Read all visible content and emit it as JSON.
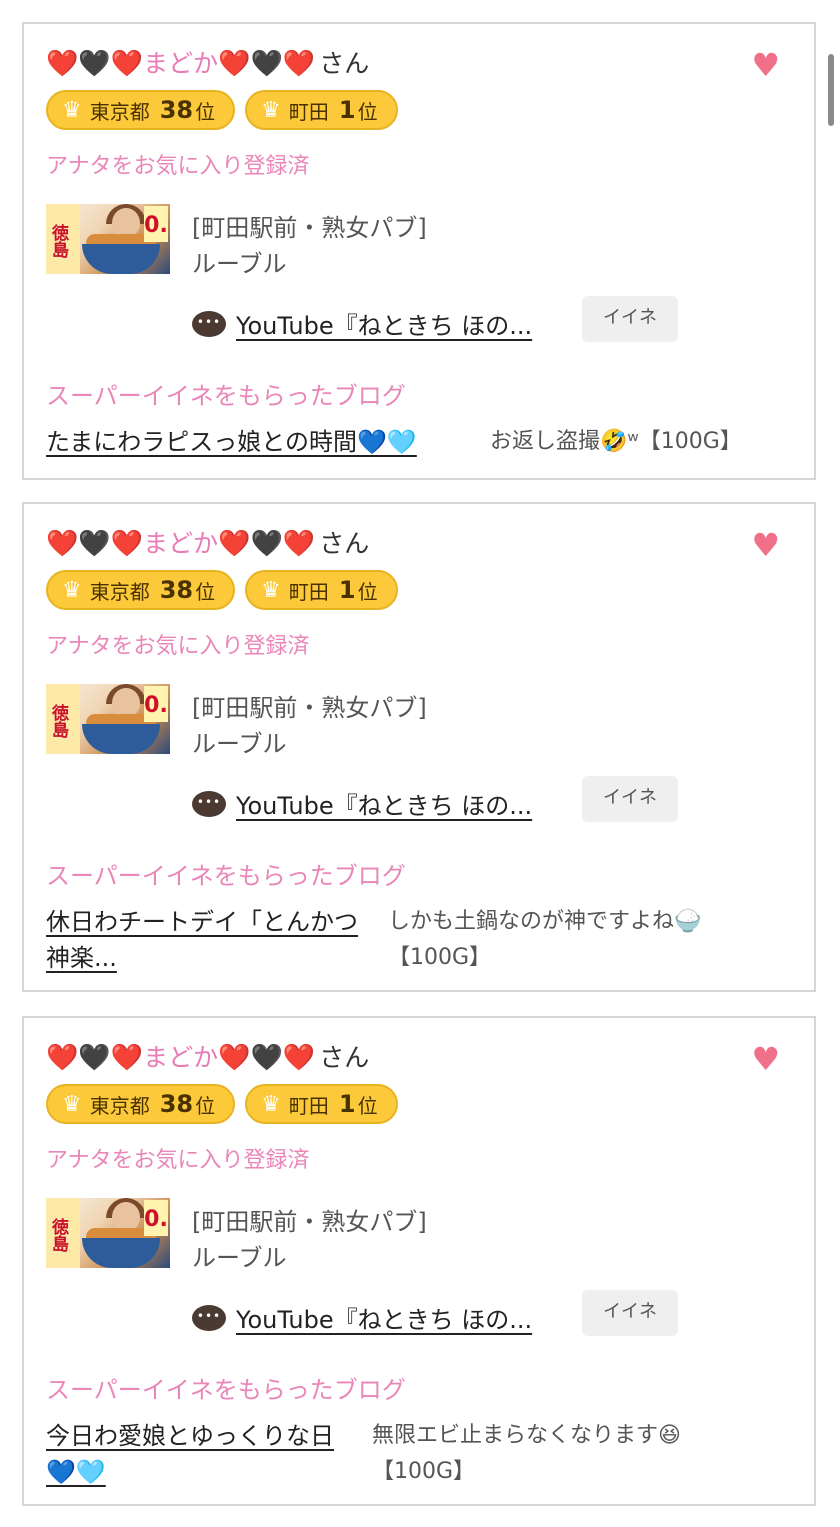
{
  "cards": [
    {
      "name_hearts_before": "❤️🖤❤️",
      "name": "まどか",
      "name_hearts_after": "❤️🖤❤️",
      "honorific": "さん",
      "rank1_area": "東京都",
      "rank1_num": "38",
      "rank1_unit": "位",
      "rank2_area": "町田",
      "rank2_num": "1",
      "rank2_unit": "位",
      "favorite_status": "アナタをお気に入り登録済",
      "shop_category": "[町田駅前・熟女パブ]",
      "shop_name": "ルーブル",
      "youtube_link": "YouTube『ねときち ほの...",
      "iine_label": "イイネ",
      "super_label": "スーパーイイネをもらったブログ",
      "blog_title": "たまにわラピスっ娘との時間💙🩵",
      "blog_comment_line1": "お返し盗撮🤣ʷ【100G】",
      "blog_comment_line2": ""
    },
    {
      "name_hearts_before": "❤️🖤❤️",
      "name": "まどか",
      "name_hearts_after": "❤️🖤❤️",
      "honorific": "さん",
      "rank1_area": "東京都",
      "rank1_num": "38",
      "rank1_unit": "位",
      "rank2_area": "町田",
      "rank2_num": "1",
      "rank2_unit": "位",
      "favorite_status": "アナタをお気に入り登録済",
      "shop_category": "[町田駅前・熟女パブ]",
      "shop_name": "ルーブル",
      "youtube_link": "YouTube『ねときち ほの...",
      "iine_label": "イイネ",
      "super_label": "スーパーイイネをもらったブログ",
      "blog_title_line1": "休日わチートデイ「とんかつ",
      "blog_title_line2": "神楽...",
      "blog_comment_line1": "しかも土鍋なのが神ですよね🍚",
      "blog_comment_line2": "【100G】"
    },
    {
      "name_hearts_before": "❤️🖤❤️",
      "name": "まどか",
      "name_hearts_after": "❤️🖤❤️",
      "honorific": "さん",
      "rank1_area": "東京都",
      "rank1_num": "38",
      "rank1_unit": "位",
      "rank2_area": "町田",
      "rank2_num": "1",
      "rank2_unit": "位",
      "favorite_status": "アナタをお気に入り登録済",
      "shop_category": "[町田駅前・熟女パブ]",
      "shop_name": "ルーブル",
      "youtube_link": "YouTube『ねときち ほの...",
      "iine_label": "イイネ",
      "super_label": "スーパーイイネをもらったブログ",
      "blog_title_line1": "今日わ愛娘とゆっくりな日",
      "blog_title_line2": "💙🩵",
      "blog_comment_line1": "無限エビ止まらなくなります😆",
      "blog_comment_line2": "【100G】"
    }
  ],
  "colors": {
    "accent_pink": "#ea86b9",
    "badge_yellow": "#fbc93a",
    "favorite_heart": "#f0708a"
  },
  "icons": {
    "favorite": "heart-icon",
    "crown": "crown-icon",
    "chat": "chat-bubble-icon"
  }
}
